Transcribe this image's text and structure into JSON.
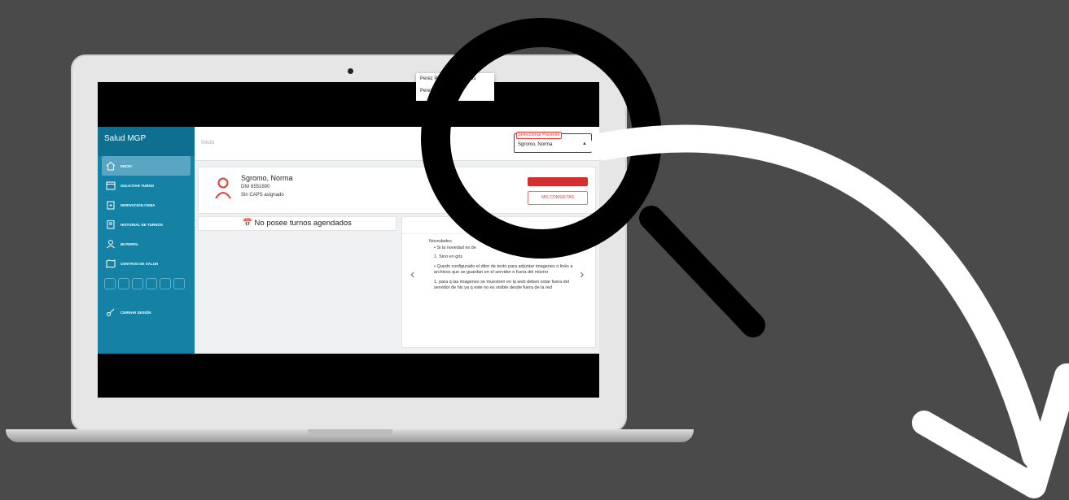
{
  "app": {
    "brand": "Salud MGP",
    "breadcrumb": "Inicio"
  },
  "sidebar": {
    "items": [
      {
        "label": "INICIO",
        "icon": "home-icon"
      },
      {
        "label": "SOLICITAR TURNO",
        "icon": "calendar-icon"
      },
      {
        "label": "DERIVACION CEMA",
        "icon": "clipboard-icon"
      },
      {
        "label": "HISTORIAL DE TURNOS",
        "icon": "history-icon"
      },
      {
        "label": "MI PERFIL",
        "icon": "user-icon"
      },
      {
        "label": "CENTROS DE SALUD",
        "icon": "map-icon"
      }
    ],
    "logout": "CERRAR SESIÓN"
  },
  "patient_select": {
    "label": "Seleccionar Paciente",
    "value": "Sgromo, Norma",
    "options": [
      "Perez Perez, Juan Carlos",
      "Perez Perez, Juana"
    ]
  },
  "patient": {
    "name": "Sgromo, Norma",
    "dni": "DNI 6551690",
    "caps": "Sin CAPS asignado"
  },
  "buttons": {
    "mis_consultas": "MIS CONSULTAS"
  },
  "turnos": {
    "empty": "No posee turnos agendados"
  },
  "novedades": {
    "title": "edades",
    "heading": "Novedades",
    "bullet1": "Si la novedad es de",
    "n1": "1. Sino en gris",
    "bullet2": "Quedo configurado el ditor de texto para adjuntar imagenes o links a archivos que se guardan en el servidor o fuera del mismo",
    "n2": "1. para q las imagenes se muestren en la web deben estar fuera del servidor de his ya q este no es visible desde fuera de la red"
  },
  "colors": {
    "sidebar": "#1582a5",
    "accent_red": "#d32f2f",
    "background": "#4a4a4a"
  }
}
